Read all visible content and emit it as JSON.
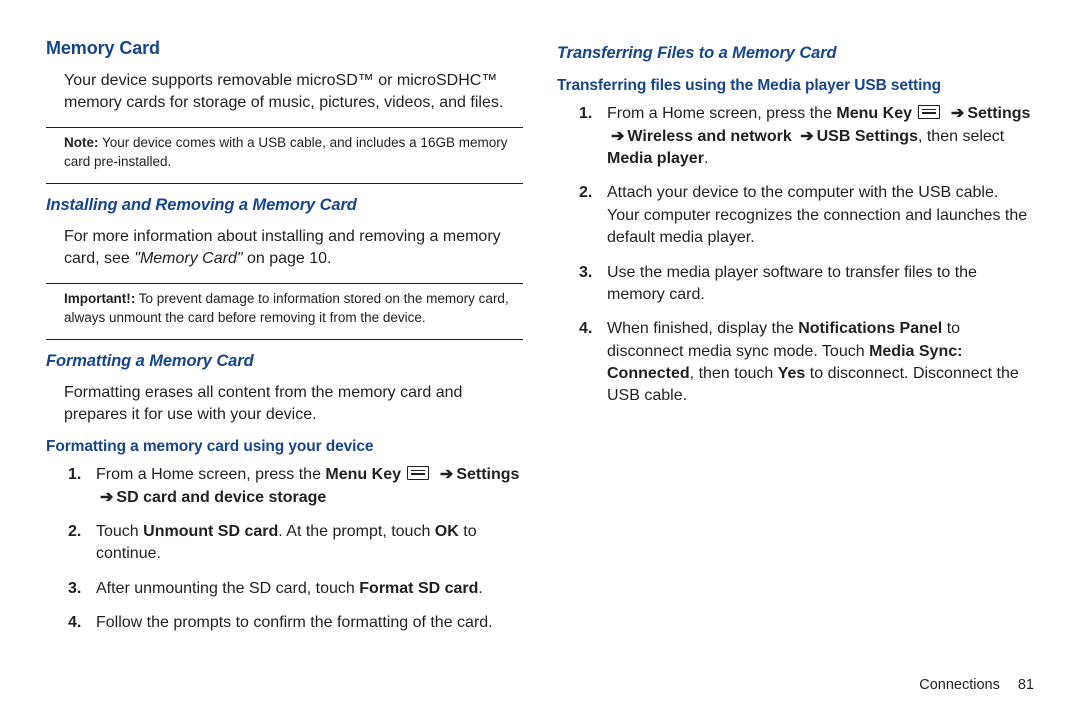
{
  "left": {
    "h1": "Memory Card",
    "intro": "Your device supports removable microSD™ or microSDHC™ memory cards for storage of music, pictures, videos, and files.",
    "noteLabel": "Note:",
    "noteText": " Your device comes with a USB cable, and includes a 16GB memory card pre-installed.",
    "h2a": "Installing and Removing a Memory Card",
    "install_pre": "For more information about installing and removing a memory card, see ",
    "install_xref": "\"Memory Card\"",
    "install_post": " on page 10.",
    "impLabel": "Important!:",
    "impText": " To prevent damage to information stored on the memory card, always unmount the card before removing it from the device.",
    "h2b": "Formatting a Memory Card",
    "formatBody": "Formatting erases all content from the memory card and prepares it for use with your device.",
    "h3": "Formatting a memory card using your device",
    "s1_pre": "From a Home screen, press the ",
    "s1_menuKey": "Menu Key",
    "s1_settings": "Settings",
    "s1_sd": "SD card and device storage",
    "s2_pre": "Touch ",
    "s2_unmount": "Unmount SD card",
    "s2_mid": ". At the prompt, touch ",
    "s2_ok": "OK",
    "s2_post": " to continue.",
    "s3_pre": "After unmounting the SD card, touch ",
    "s3_format": "Format SD card",
    "s3_post": ".",
    "s4": "Follow the prompts to confirm the formatting of the card."
  },
  "right": {
    "h2": "Transferring Files to a Memory Card",
    "h3": "Transferring files using the Media player USB setting",
    "s1_pre": "From a Home screen, press the ",
    "s1_menuKey": "Menu Key",
    "s1_settings": "Settings",
    "s1_wn": "Wireless and network",
    "s1_usb": "USB Settings",
    "s1_mid": ", then select ",
    "s1_mp": "Media player",
    "s1_post": ".",
    "s2": "Attach your device to the computer with the USB cable. Your computer recognizes the connection and launches the default media player.",
    "s3": "Use the media player software to transfer files to the memory card.",
    "s4_pre": "When finished, display the ",
    "s4_np": "Notifications Panel",
    "s4_mid1": " to disconnect media sync mode. Touch ",
    "s4_msc": "Media Sync: Connected",
    "s4_mid2": ", then touch ",
    "s4_yes": "Yes",
    "s4_post": " to disconnect. Disconnect the USB cable."
  },
  "arrow": "➔",
  "footer": {
    "section": "Connections",
    "page": "81"
  }
}
